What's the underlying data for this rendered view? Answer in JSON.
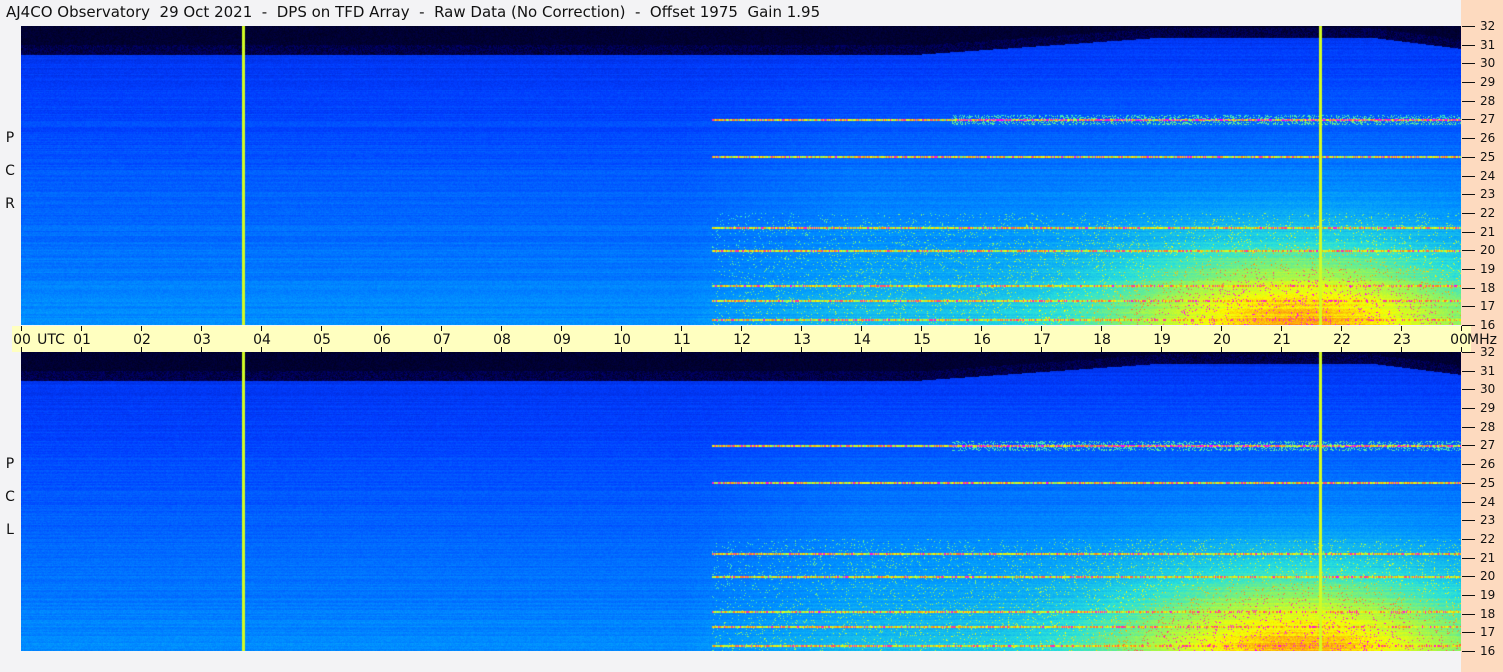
{
  "title": "AJ4CO Observatory  29 Oct 2021  -  DPS on TFD Array  -  Raw Data (No Correction)  -  Offset 1975  Gain 1.95",
  "chart_data": {
    "type": "heatmap",
    "title": "AJ4CO Observatory  29 Oct 2021  -  DPS on TFD Array  -  Raw Data (No Correction)  -  Offset 1975  Gain 1.95",
    "xlabel": "UTC",
    "ylabel": "MHz",
    "xlim": [
      0,
      24
    ],
    "ylim": [
      16,
      32
    ],
    "x_ticks": [
      "00",
      "01",
      "02",
      "03",
      "04",
      "05",
      "06",
      "07",
      "08",
      "09",
      "10",
      "11",
      "12",
      "13",
      "14",
      "15",
      "16",
      "17",
      "18",
      "19",
      "20",
      "21",
      "22",
      "23",
      "00"
    ],
    "y_ticks": [
      16,
      17,
      18,
      19,
      20,
      21,
      22,
      23,
      24,
      25,
      26,
      27,
      28,
      29,
      30,
      31,
      32
    ],
    "panels": [
      {
        "name": "RCP",
        "letters": [
          "R",
          "C",
          "P"
        ]
      },
      {
        "name": "LCP",
        "letters": [
          "L",
          "C",
          "P"
        ]
      }
    ],
    "vertical_markers_utc": [
      3.7,
      21.65
    ],
    "interference_lines_mhz": [
      27.0,
      25.0,
      21.2,
      20.0,
      18.1,
      17.3,
      16.3
    ],
    "colors": {
      "background": "#000000",
      "low": "#0040ff",
      "mid": "#00c0ff",
      "high": "#f0ff00",
      "peak": "#ff00ff",
      "marker": "#c8f000"
    }
  }
}
